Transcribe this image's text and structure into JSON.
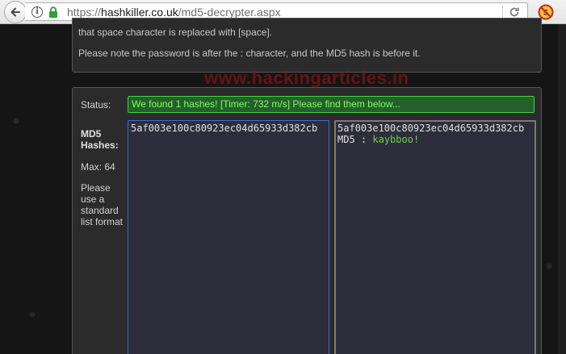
{
  "browser": {
    "url_scheme": "https://",
    "url_domain": "hashkiller.co.uk",
    "url_path": "/md5-decrypter.aspx",
    "icons": {
      "back": "back-arrow-icon",
      "info": "info-icon",
      "lock": "lock-icon",
      "reload": "reload-icon",
      "addon": "noscript-addon-icon"
    }
  },
  "notes": {
    "line1": "that space character is replaced with [space].",
    "line2": "Please note the password is after the : character, and the MD5 hash is before it."
  },
  "watermark": "www.hackingarticles.in",
  "form": {
    "status_label": "Status:",
    "status_text": "We found 1 hashes! [Timer: 732 m/s] Please find them below...",
    "field_label": "MD5 Hashes:",
    "max_label": "Max: 64",
    "hint": "Please use a standard list format",
    "input_value": "5af003e100c80923ec04d65933d382cb",
    "result": {
      "hash": "5af003e100c80923ec04d65933d382cb",
      "type": "MD5",
      "separator": " : ",
      "password": "kaybboo!"
    }
  },
  "colors": {
    "status_bg": "#23602a",
    "status_border": "#3fd53f",
    "status_text": "#7fff5a",
    "password_text": "#6bd24a",
    "watermark": "#aa1414",
    "input_border": "#3a6bd4"
  }
}
